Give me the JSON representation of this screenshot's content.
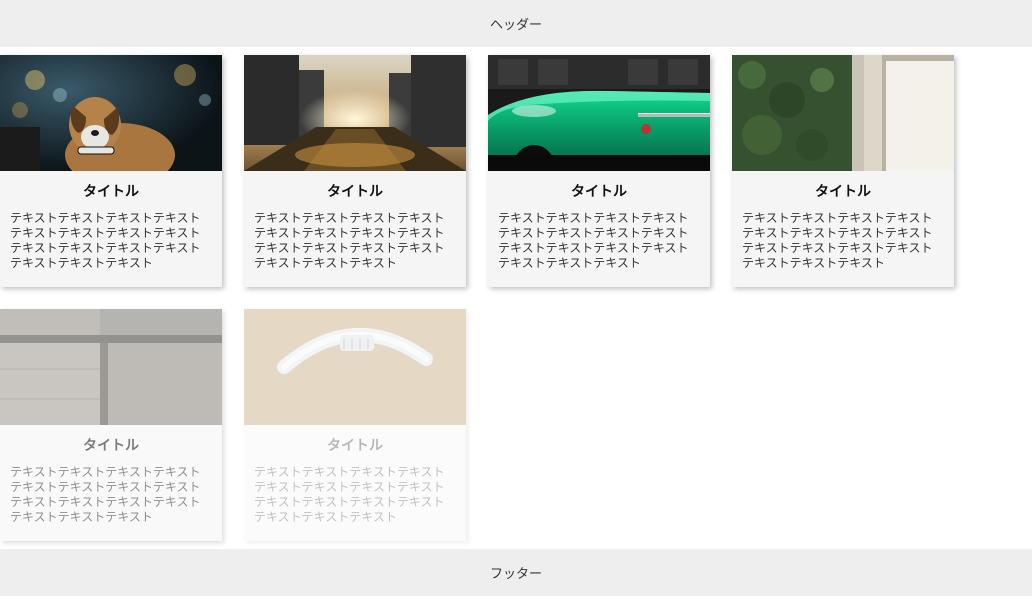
{
  "header": {
    "label": "ヘッダー"
  },
  "footer": {
    "label": "フッター"
  },
  "card_defaults": {
    "title": "タイトル",
    "text": "テキストテキストテキストテキストテキストテキストテキストテキストテキストテキストテキストテキストテキストテキストテキスト"
  },
  "cards": [
    {
      "title": "タイトル",
      "text": "テキストテキストテキストテキストテキストテキストテキストテキストテキストテキストテキストテキストテキストテキストテキスト",
      "image": "dog"
    },
    {
      "title": "タイトル",
      "text": "テキストテキストテキストテキストテキストテキストテキストテキストテキストテキストテキストテキストテキストテキストテキスト",
      "image": "street"
    },
    {
      "title": "タイトル",
      "text": "テキストテキストテキストテキストテキストテキストテキストテキストテキストテキストテキストテキストテキストテキストテキスト",
      "image": "car"
    },
    {
      "title": "タイトル",
      "text": "テキストテキストテキストテキストテキストテキストテキストテキストテキストテキストテキストテキストテキストテキストテキスト",
      "image": "window"
    },
    {
      "title": "タイトル",
      "text": "テキストテキストテキストテキストテキストテキストテキストテキストテキストテキストテキストテキストテキストテキストテキスト",
      "image": "wall",
      "fade": 1
    },
    {
      "title": "タイトル",
      "text": "テキストテキストテキストテキストテキストテキストテキストテキストテキストテキストテキストテキストテキストテキストテキスト",
      "image": "hook",
      "fade": 2
    }
  ]
}
